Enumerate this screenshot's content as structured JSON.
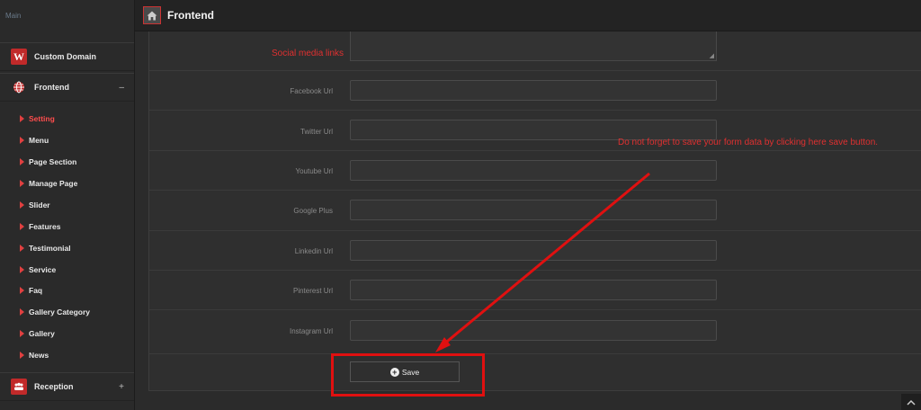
{
  "sidebar": {
    "main_label": "Main",
    "main_sub": "",
    "items": [
      {
        "label": "Custom Domain",
        "icon": "wordpress-icon"
      },
      {
        "label": "Frontend",
        "icon": "globe-icon",
        "toggle": "–"
      },
      {
        "label": "Reception",
        "icon": "users-icon",
        "toggle": "+"
      }
    ],
    "submenu": [
      "Setting",
      "Menu",
      "Page Section",
      "Manage Page",
      "Slider",
      "Features",
      "Testimonial",
      "Service",
      "Faq",
      "Gallery Category",
      "Gallery",
      "News"
    ],
    "active_submenu": "Setting"
  },
  "header": {
    "title": "Frontend",
    "home_icon": "home-icon"
  },
  "form": {
    "section_title": "Social media links",
    "fields": [
      {
        "label": "Facebook Url",
        "value": ""
      },
      {
        "label": "Twitter Url",
        "value": ""
      },
      {
        "label": "Youtube Url",
        "value": ""
      },
      {
        "label": "Google Plus",
        "value": ""
      },
      {
        "label": "Linkedin Url",
        "value": ""
      },
      {
        "label": "Pinterest Url",
        "value": ""
      },
      {
        "label": "Instagram Url",
        "value": ""
      }
    ],
    "save_label": "Save"
  },
  "annotation": {
    "text": "Do not forget to save your form data by clicking here save button."
  },
  "colors": {
    "accent": "#e03030",
    "background": "#2b2b2b"
  }
}
